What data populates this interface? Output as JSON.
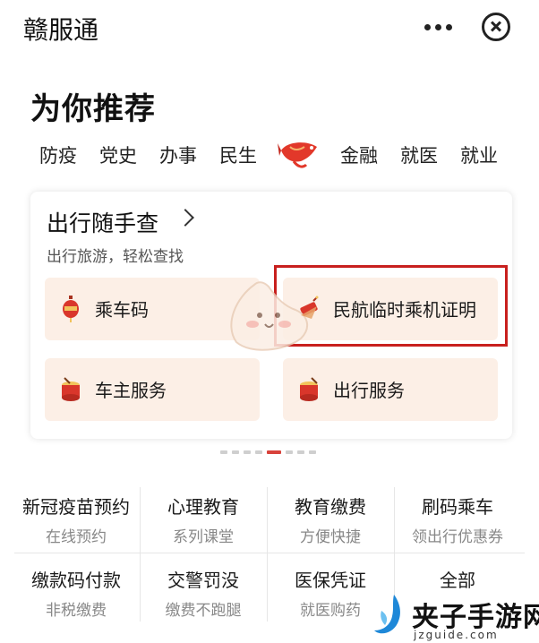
{
  "header": {
    "title": "赣服通"
  },
  "recommend": {
    "title": "为你推荐",
    "tabs": [
      "防疫",
      "党史",
      "办事",
      "民生",
      "金融",
      "就医",
      "就业"
    ]
  },
  "travel_card": {
    "title": "出行随手查",
    "subtitle": "出行旅游，轻松查找",
    "tiles": [
      {
        "label": "乘车码",
        "icon": "lantern-icon"
      },
      {
        "label": "民航临时乘机证明",
        "icon": "firecracker-icon"
      },
      {
        "label": "车主服务",
        "icon": "drum-icon"
      },
      {
        "label": "出行服务",
        "icon": "drum-icon"
      }
    ]
  },
  "pager": {
    "total": 7,
    "active": 4
  },
  "services": [
    {
      "title": "新冠疫苗预约",
      "sub": "在线预约"
    },
    {
      "title": "心理教育",
      "sub": "系列课堂"
    },
    {
      "title": "教育缴费",
      "sub": "方便快捷"
    },
    {
      "title": "刷码乘车",
      "sub": "领出行优惠券"
    },
    {
      "title": "缴款码付款",
      "sub": "非税缴费"
    },
    {
      "title": "交警罚没",
      "sub": "缴费不跑腿"
    },
    {
      "title": "医保凭证",
      "sub": "就医购药"
    },
    {
      "title": "全部",
      "sub": ""
    }
  ],
  "watermark": {
    "text": "夹子手游网",
    "url": "jzguide.com"
  },
  "colors": {
    "accent_red": "#c8201e",
    "tile_bg": "#fcefe6"
  }
}
